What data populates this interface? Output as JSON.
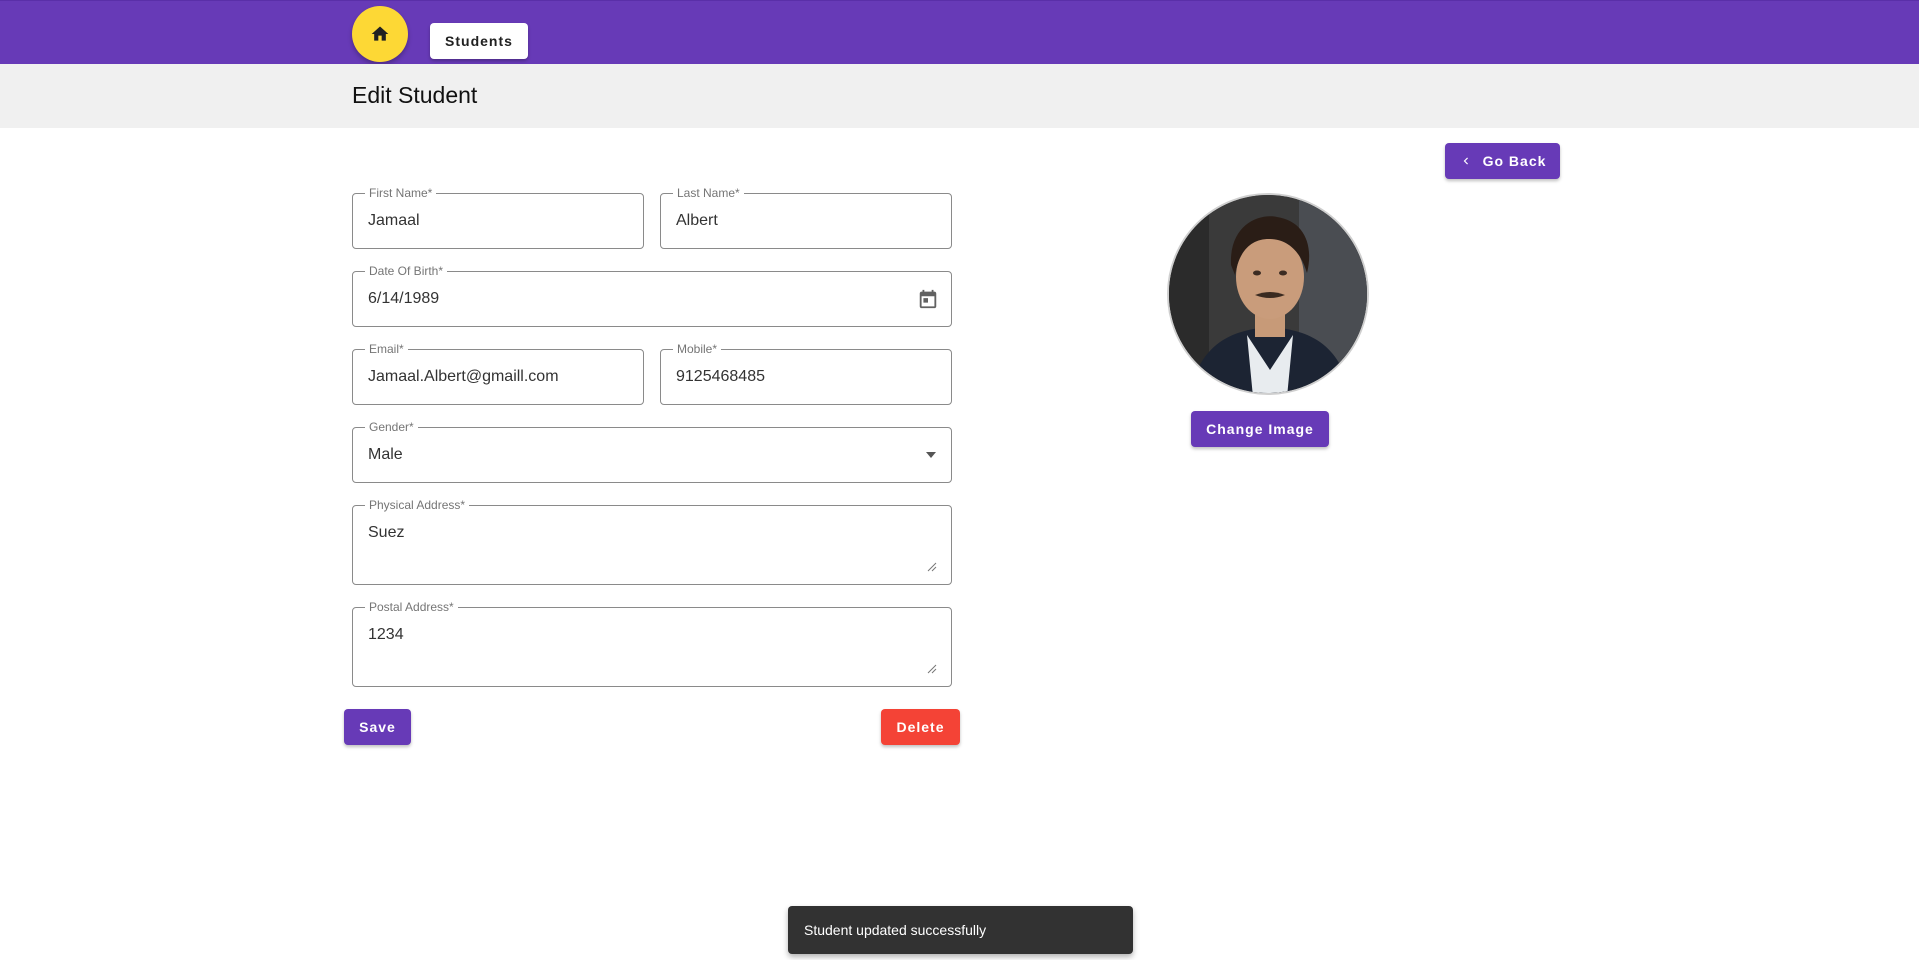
{
  "nav": {
    "home_icon": "home-icon",
    "students_label": "Students"
  },
  "page": {
    "title": "Edit Student"
  },
  "actions": {
    "go_back_label": "Go Back",
    "go_back_icon": "chevron-left-icon",
    "change_image_label": "Change Image",
    "save_label": "Save",
    "delete_label": "Delete"
  },
  "form": {
    "first_name": {
      "label": "First Name*",
      "value": "Jamaal"
    },
    "last_name": {
      "label": "Last Name*",
      "value": "Albert"
    },
    "dob": {
      "label": "Date Of Birth*",
      "value": "6/14/1989",
      "icon": "calendar-icon"
    },
    "email": {
      "label": "Email*",
      "value": "Jamaal.Albert@gmaill.com"
    },
    "mobile": {
      "label": "Mobile*",
      "value": "9125468485"
    },
    "gender": {
      "label": "Gender*",
      "value": "Male",
      "icon": "caret-down-icon"
    },
    "physical_address": {
      "label": "Physical Address*",
      "value": "Suez"
    },
    "postal_address": {
      "label": "Postal Address*",
      "value": "1234"
    }
  },
  "snackbar": {
    "message": "Student updated successfully"
  },
  "colors": {
    "primary": "#673ab7",
    "accent": "#fdd835",
    "danger": "#f44336"
  }
}
